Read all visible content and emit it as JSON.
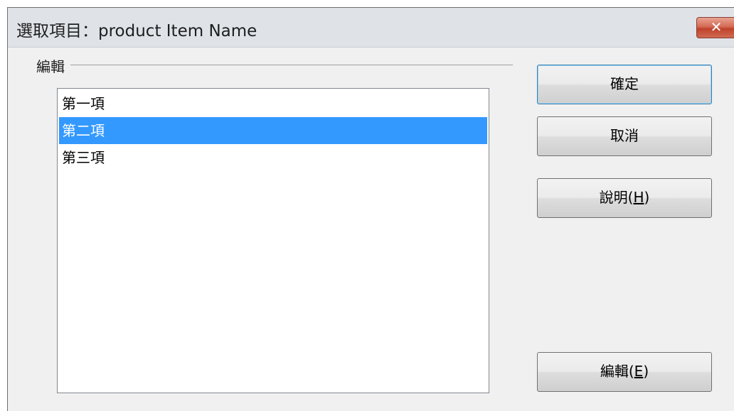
{
  "window": {
    "title": "選取項目：product  Item Name",
    "close_glyph": "✕"
  },
  "group": {
    "label": "編輯"
  },
  "list": {
    "items": [
      {
        "label": "第一項",
        "selected": false
      },
      {
        "label": "第二項",
        "selected": true
      },
      {
        "label": "第三項",
        "selected": false
      }
    ]
  },
  "buttons": {
    "ok": {
      "label": "確定"
    },
    "cancel": {
      "label": "取消"
    },
    "help": {
      "label_before": "說明(",
      "accel": "H",
      "label_after": ")"
    },
    "edit": {
      "label_before": "編輯(",
      "accel": "E",
      "label_after": ")"
    }
  },
  "colors": {
    "selection": "#3399ff",
    "close_button": "#c0422b",
    "default_button_border": "#3c7fb1"
  }
}
